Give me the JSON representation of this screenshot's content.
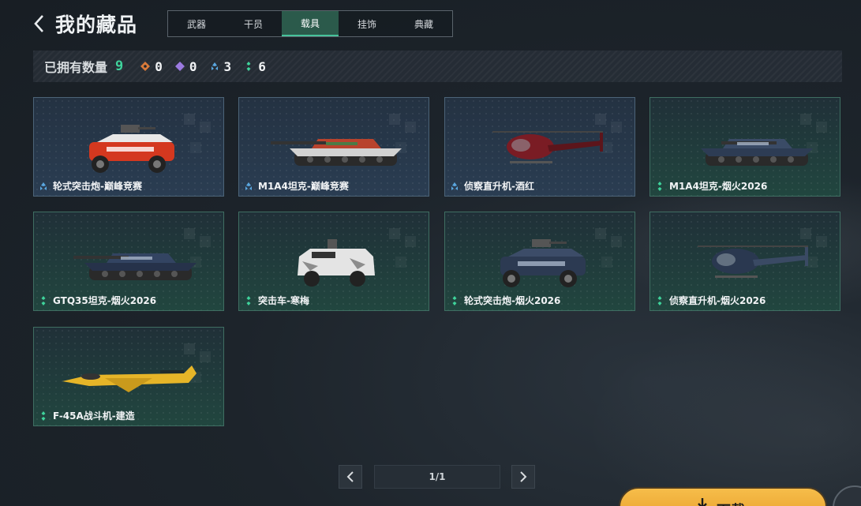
{
  "header": {
    "title": "我的藏品"
  },
  "tabs": [
    {
      "label": "武器",
      "active": false
    },
    {
      "label": "干员",
      "active": false
    },
    {
      "label": "载具",
      "active": true
    },
    {
      "label": "挂饰",
      "active": false
    },
    {
      "label": "典藏",
      "active": false
    }
  ],
  "summary": {
    "label": "已拥有数量",
    "total": "9",
    "rarities": [
      {
        "icon": "orange-rarity-icon",
        "color": "#d97a3a",
        "count": "0"
      },
      {
        "icon": "purple-rarity-icon",
        "color": "#9b7ae0",
        "count": "0"
      },
      {
        "icon": "blue-rarity-icon",
        "color": "#5aa7e0",
        "count": "3"
      },
      {
        "icon": "green-rarity-icon",
        "color": "#3fd49c",
        "count": "6"
      }
    ]
  },
  "items": [
    {
      "name": "轮式突击炮-巅峰竞赛",
      "rarity": "blue",
      "vehicle": "wheeled-assault-gun-vehicle"
    },
    {
      "name": "M1A4坦克-巅峰竞赛",
      "rarity": "blue",
      "vehicle": "tank-vehicle"
    },
    {
      "name": "侦察直升机-酒红",
      "rarity": "blue",
      "vehicle": "helicopter-vehicle"
    },
    {
      "name": "M1A4坦克-烟火2026",
      "rarity": "green",
      "vehicle": "tank-vehicle"
    },
    {
      "name": "GTQ35坦克-烟火2026",
      "rarity": "green",
      "vehicle": "tank-vehicle"
    },
    {
      "name": "突击车-寒梅",
      "rarity": "green",
      "vehicle": "assault-car-vehicle"
    },
    {
      "name": "轮式突击炮-烟火2026",
      "rarity": "green",
      "vehicle": "wheeled-assault-gun-vehicle"
    },
    {
      "name": "侦察直升机-烟火2026",
      "rarity": "green",
      "vehicle": "helicopter-vehicle"
    },
    {
      "name": "F-45A战斗机-建造",
      "rarity": "green",
      "vehicle": "fighter-jet-vehicle"
    }
  ],
  "pagination": {
    "indicator": "1/1"
  },
  "download_button": {
    "label": "下载"
  }
}
